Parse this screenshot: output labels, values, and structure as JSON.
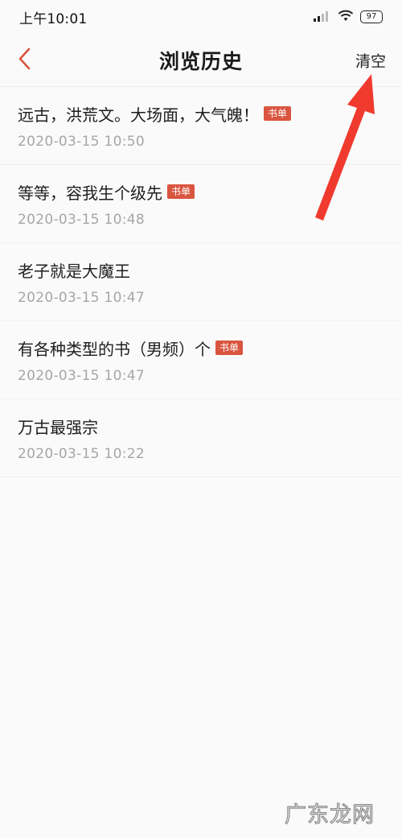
{
  "status_bar": {
    "time": "上午10:01",
    "battery": "97",
    "signal_icon": "signal-icon",
    "wifi_icon": "wifi-icon"
  },
  "header": {
    "title": "浏览历史",
    "clear_label": "清空",
    "back_icon": "chevron-left-icon"
  },
  "history": {
    "items": [
      {
        "title": "远古，洪荒文。大场面，大气魄！",
        "tag": "书单",
        "time": "2020-03-15 10:50"
      },
      {
        "title": "等等，容我生个级先",
        "tag": "书单",
        "time": "2020-03-15 10:48"
      },
      {
        "title": "老子就是大魔王",
        "tag": "",
        "time": "2020-03-15 10:47"
      },
      {
        "title": "有各种类型的书（男频）个",
        "tag": "书单",
        "time": "2020-03-15 10:47"
      },
      {
        "title": "万古最强宗",
        "tag": "",
        "time": "2020-03-15 10:22"
      }
    ]
  },
  "watermark": "广东龙网",
  "colors": {
    "accent": "#d9553f",
    "tag_bg": "#d9553f",
    "annotation": "#f03a2e",
    "time_text": "#a6a6a6"
  }
}
